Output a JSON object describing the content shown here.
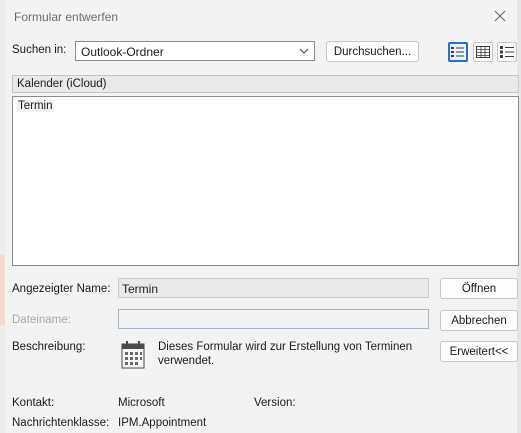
{
  "dialog": {
    "title": "Formular entwerfen"
  },
  "search": {
    "label": "Suchen in:",
    "value": "Outlook-Ordner",
    "browse_label": "Durchsuchen..."
  },
  "list": {
    "header": "Kalender (iCloud)",
    "items": [
      "Termin"
    ]
  },
  "form": {
    "display_name_label": "Angezeigter Name:",
    "display_name_value": "Termin",
    "filename_label": "Dateiname:",
    "filename_value": "",
    "description_label": "Beschreibung:",
    "description_text": "Dieses Formular wird zur Erstellung von Terminen verwendet."
  },
  "buttons": {
    "open": "Öffnen",
    "cancel": "Abbrechen",
    "advanced": "Erweitert<<"
  },
  "details": {
    "contact_label": "Kontakt:",
    "contact_value": "Microsoft",
    "version_label": "Version:",
    "version_value": "",
    "message_class_label": "Nachrichtenklasse:",
    "message_class_value": "IPM.Appointment"
  },
  "icons": {
    "close": "close-icon",
    "dropdown": "chevron-down-icon",
    "view_large": "large-icons-view-icon",
    "view_small": "small-icons-view-icon",
    "view_details": "details-view-icon",
    "form": "calendar-form-icon"
  },
  "colors": {
    "accent": "#2b6ec8",
    "background": "#f3f3f3"
  }
}
